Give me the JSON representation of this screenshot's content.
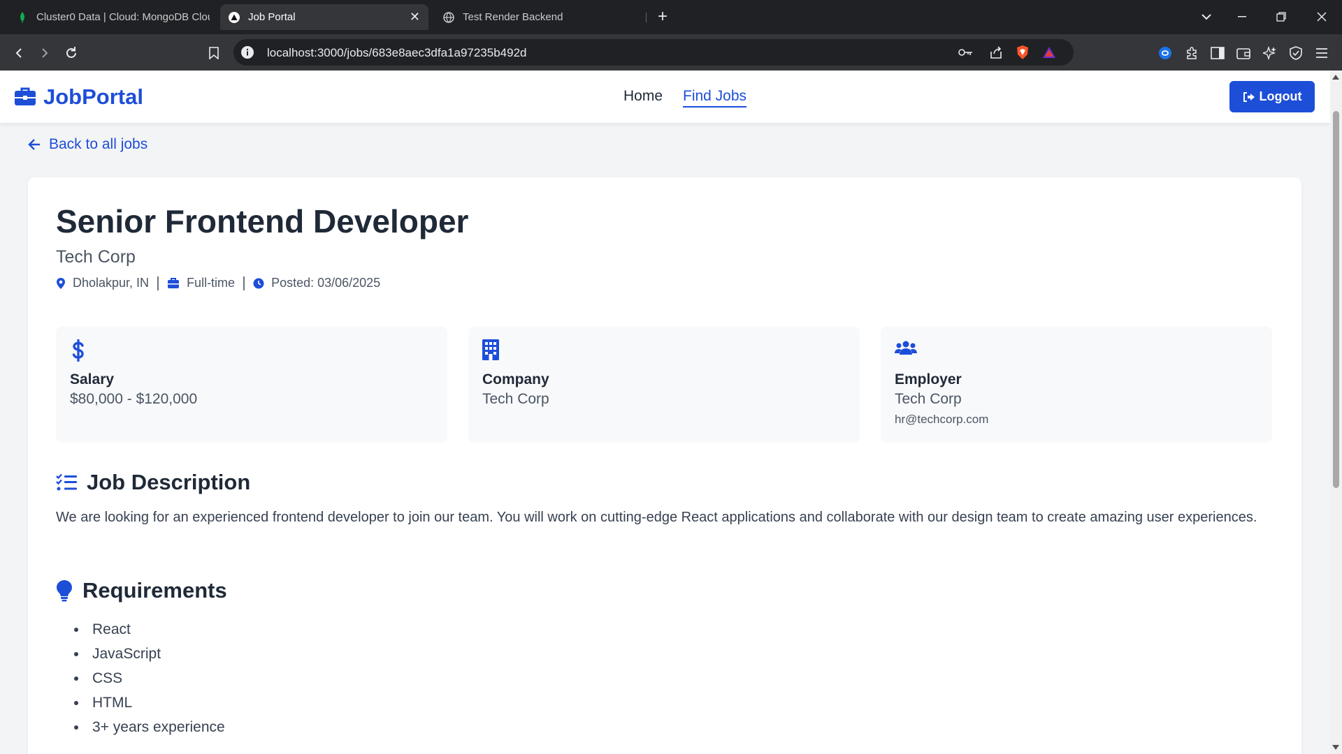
{
  "browser": {
    "tabs": [
      {
        "title": "Cluster0 Data | Cloud: MongoDB Cloud",
        "favicon": "mongodb-leaf-icon",
        "active": false
      },
      {
        "title": "Job Portal",
        "favicon": "triangle-app-icon",
        "active": true
      },
      {
        "title": "Test Render Backend",
        "favicon": "globe-icon",
        "active": false
      }
    ],
    "url": "localhost:3000/jobs/683e8aec3dfa1a97235b492d"
  },
  "navbar": {
    "brand": "JobPortal",
    "links": [
      {
        "label": "Home",
        "active": false
      },
      {
        "label": "Find Jobs",
        "active": true
      }
    ],
    "logout_label": "Logout"
  },
  "back_link": "Back to all jobs",
  "job": {
    "title": "Senior Frontend Developer",
    "company": "Tech Corp",
    "location": "Dholakpur, IN",
    "type": "Full-time",
    "posted": "Posted: 03/06/2025"
  },
  "info_cards": {
    "salary": {
      "label": "Salary",
      "value": "$80,000 - $120,000"
    },
    "company": {
      "label": "Company",
      "value": "Tech Corp"
    },
    "employer": {
      "label": "Employer",
      "value": "Tech Corp",
      "email": "hr@techcorp.com"
    }
  },
  "description": {
    "heading": "Job Description",
    "text": "We are looking for an experienced frontend developer to join our team. You will work on cutting-edge React applications and collaborate with our design team to create amazing user experiences."
  },
  "requirements": {
    "heading": "Requirements",
    "items": [
      "React",
      "JavaScript",
      "CSS",
      "HTML",
      "3+ years experience"
    ]
  },
  "colors": {
    "accent": "#1d4ed8",
    "heading": "#1f2937",
    "text": "#4b5563",
    "page_bg": "#f3f4f6"
  }
}
